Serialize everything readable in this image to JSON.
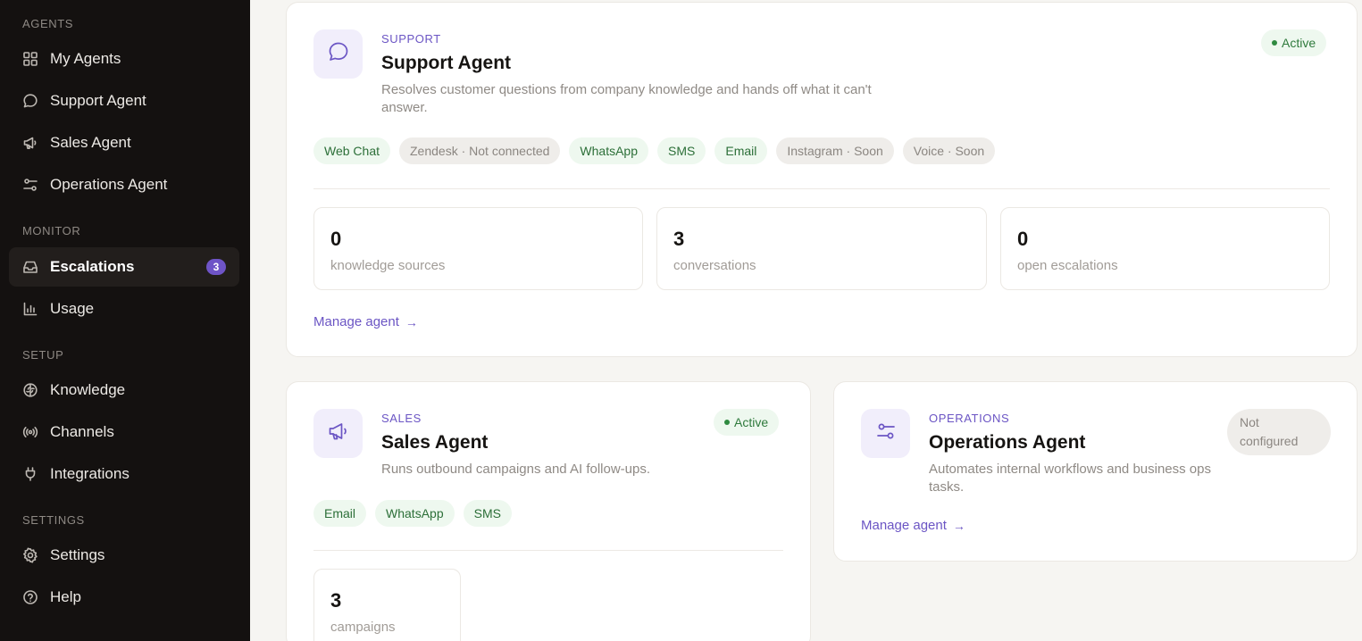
{
  "sidebar": {
    "sections": {
      "agents": "AGENTS",
      "monitor": "MONITOR",
      "setup": "SETUP",
      "settings": "SETTINGS"
    },
    "items": {
      "my_agents": "My Agents",
      "support_agent": "Support Agent",
      "sales_agent": "Sales Agent",
      "operations_agent": "Operations Agent",
      "escalations": "Escalations",
      "escalations_badge": "3",
      "usage": "Usage",
      "knowledge": "Knowledge",
      "channels": "Channels",
      "integrations": "Integrations",
      "settings": "Settings",
      "help": "Help"
    }
  },
  "support_card": {
    "category": "SUPPORT",
    "title": "Support Agent",
    "description": "Resolves customer questions from company knowledge and hands off what it can't answer.",
    "status": "Active",
    "channels": [
      {
        "label": "Web Chat",
        "state": "on"
      },
      {
        "label": "Zendesk · Not connected",
        "state": "off"
      },
      {
        "label": "WhatsApp",
        "state": "on"
      },
      {
        "label": "SMS",
        "state": "on"
      },
      {
        "label": "Email",
        "state": "on"
      },
      {
        "label": "Instagram · Soon",
        "state": "off"
      },
      {
        "label": "Voice · Soon",
        "state": "off"
      }
    ],
    "stats": [
      {
        "value": "0",
        "label": "knowledge sources"
      },
      {
        "value": "3",
        "label": "conversations"
      },
      {
        "value": "0",
        "label": "open escalations"
      }
    ],
    "manage_label": "Manage agent",
    "arrow": "→"
  },
  "sales_card": {
    "category": "SALES",
    "title": "Sales Agent",
    "description": "Runs outbound campaigns and AI follow-ups.",
    "status": "Active",
    "channels": [
      {
        "label": "Email",
        "state": "on"
      },
      {
        "label": "WhatsApp",
        "state": "on"
      },
      {
        "label": "SMS",
        "state": "on"
      }
    ],
    "stats": [
      {
        "value": "3",
        "label": "campaigns"
      }
    ]
  },
  "operations_card": {
    "category": "OPERATIONS",
    "title": "Operations Agent",
    "description": "Automates internal workflows and business ops tasks.",
    "status": "Not configured",
    "manage_label": "Manage agent",
    "arrow": "→"
  },
  "colors": {
    "accent": "#6b55c4",
    "active_green": "#2f7a3c",
    "sidebar_bg": "#141110",
    "badge": "#6e54c7"
  }
}
